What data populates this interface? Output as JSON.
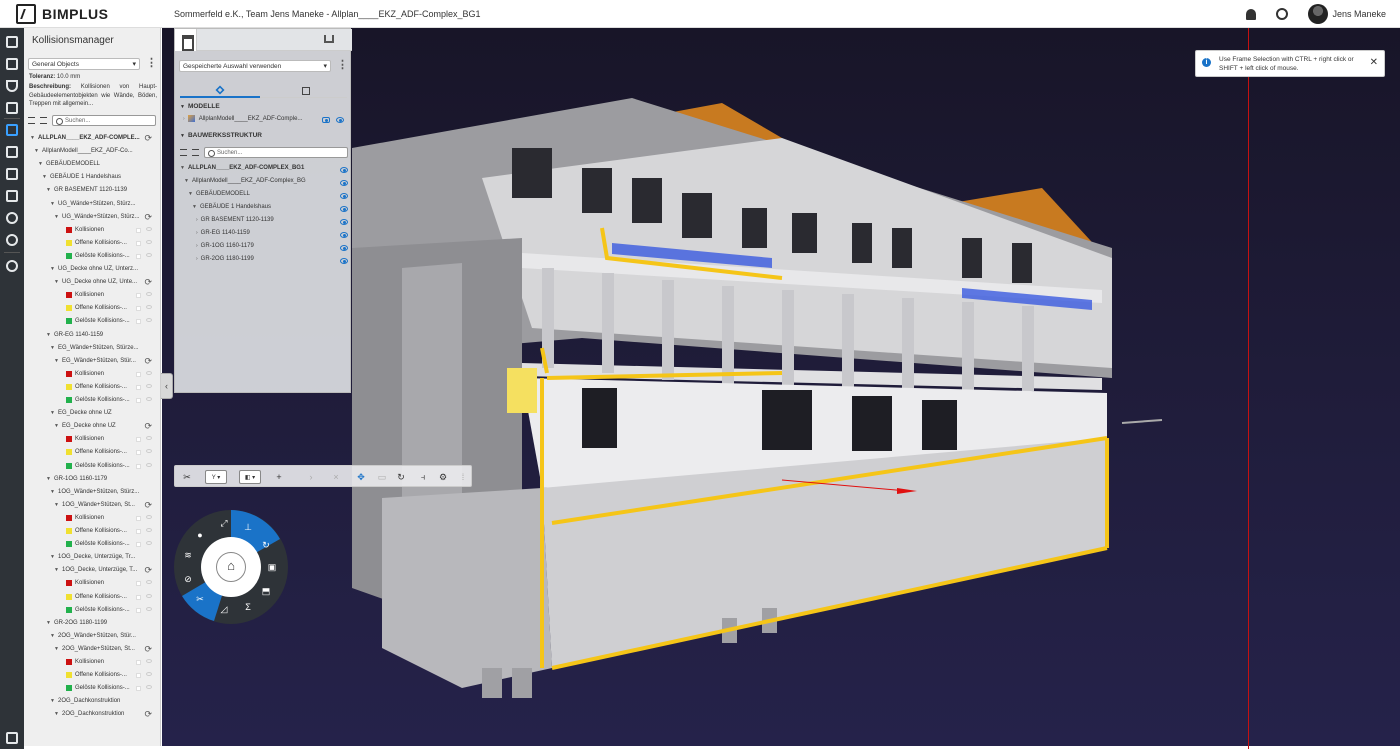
{
  "brand": {
    "name": "BIMPLUS"
  },
  "header": {
    "project_title": "Sommerfeld e.K., Team Jens Maneke  -  Allplan____EKZ_ADF-Complex_BG1",
    "user_name": "Jens Maneke"
  },
  "collision_panel": {
    "title": "Kollisionsmanager",
    "filter_select": "General Objects",
    "tolerance_label": "Toleranz:",
    "tolerance_value": "10.0 mm",
    "description_label": "Beschreibung:",
    "description_text": "Kollisionen von Haupt-Gebäudeelementobjekten wie Wände, Böden, Treppen mit allgemein...",
    "search_placeholder": "Suchen...",
    "tree": [
      {
        "label": "ALLPLAN____EKZ_ADF-COMPLE...",
        "level": 0,
        "kind": "root"
      },
      {
        "label": "AllplanModell____EKZ_ADF-Co...",
        "level": 1,
        "kind": "node"
      },
      {
        "label": "GEBÄUDEMODELL",
        "level": 2,
        "kind": "node"
      },
      {
        "label": "GEBÄUDE 1 Handelshaus",
        "level": 3,
        "kind": "node"
      },
      {
        "label": "GR BASEMENT 1120-1139",
        "level": 4,
        "kind": "node"
      },
      {
        "label": "UG_Wände+Stützen, Stürz...",
        "level": 5,
        "kind": "node"
      },
      {
        "label": "UG_Wände+Stützen, Stürz...",
        "level": 6,
        "kind": "sync"
      },
      {
        "label": "Kollisionen",
        "level": 7,
        "kind": "red"
      },
      {
        "label": "Offene Kollisions-...",
        "level": 7,
        "kind": "yellow"
      },
      {
        "label": "Gelöste Kollisions-...",
        "level": 7,
        "kind": "green"
      },
      {
        "label": "UG_Decke ohne UZ, Unterz...",
        "level": 5,
        "kind": "node"
      },
      {
        "label": "UG_Decke ohne UZ, Unte...",
        "level": 6,
        "kind": "sync"
      },
      {
        "label": "Kollisionen",
        "level": 7,
        "kind": "red"
      },
      {
        "label": "Offene Kollisions-...",
        "level": 7,
        "kind": "yellow"
      },
      {
        "label": "Gelöste Kollisions-...",
        "level": 7,
        "kind": "green"
      },
      {
        "label": "GR-EG 1140-1159",
        "level": 4,
        "kind": "node"
      },
      {
        "label": "EG_Wände+Stützen, Stürze...",
        "level": 5,
        "kind": "node"
      },
      {
        "label": "EG_Wände+Stützen, Stür...",
        "level": 6,
        "kind": "sync"
      },
      {
        "label": "Kollisionen",
        "level": 7,
        "kind": "red"
      },
      {
        "label": "Offene Kollisions-...",
        "level": 7,
        "kind": "yellow"
      },
      {
        "label": "Gelöste Kollisions-...",
        "level": 7,
        "kind": "green"
      },
      {
        "label": "EG_Decke ohne UZ",
        "level": 5,
        "kind": "node"
      },
      {
        "label": "EG_Decke ohne UZ",
        "level": 6,
        "kind": "sync"
      },
      {
        "label": "Kollisionen",
        "level": 7,
        "kind": "red"
      },
      {
        "label": "Offene Kollisions-...",
        "level": 7,
        "kind": "yellow"
      },
      {
        "label": "Gelöste Kollisions-...",
        "level": 7,
        "kind": "green"
      },
      {
        "label": "GR-1OG 1160-1179",
        "level": 4,
        "kind": "node"
      },
      {
        "label": "1OG_Wände+Stützen, Stürz...",
        "level": 5,
        "kind": "node"
      },
      {
        "label": "1OG_Wände+Stützen, St...",
        "level": 6,
        "kind": "sync"
      },
      {
        "label": "Kollisionen",
        "level": 7,
        "kind": "red"
      },
      {
        "label": "Offene Kollisions-...",
        "level": 7,
        "kind": "yellow"
      },
      {
        "label": "Gelöste Kollisions-...",
        "level": 7,
        "kind": "green"
      },
      {
        "label": "1OG_Decke, Unterzüge, Tr...",
        "level": 5,
        "kind": "node"
      },
      {
        "label": "1OG_Decke, Unterzüge, T...",
        "level": 6,
        "kind": "sync"
      },
      {
        "label": "Kollisionen",
        "level": 7,
        "kind": "red"
      },
      {
        "label": "Offene Kollisions-...",
        "level": 7,
        "kind": "yellow"
      },
      {
        "label": "Gelöste Kollisions-...",
        "level": 7,
        "kind": "green"
      },
      {
        "label": "GR-2OG 1180-1199",
        "level": 4,
        "kind": "node"
      },
      {
        "label": "2OG_Wände+Stützen, Stür...",
        "level": 5,
        "kind": "node"
      },
      {
        "label": "2OG_Wände+Stützen, St...",
        "level": 6,
        "kind": "sync"
      },
      {
        "label": "Kollisionen",
        "level": 7,
        "kind": "red"
      },
      {
        "label": "Offene Kollisions-...",
        "level": 7,
        "kind": "yellow"
      },
      {
        "label": "Gelöste Kollisions-...",
        "level": 7,
        "kind": "green"
      },
      {
        "label": "2OG_Dachkonstruktion",
        "level": 5,
        "kind": "node"
      },
      {
        "label": "2OG_Dachkonstruktion",
        "level": 6,
        "kind": "sync"
      }
    ]
  },
  "structure_panel": {
    "selection_select": "Gespeicherte Auswahl verwenden",
    "models_title": "MODELLE",
    "model_item": "AllplanModell____EKZ_ADF-Comple...",
    "structure_title": "BAUWERKSSTRUKTUR",
    "search_placeholder": "Suchen...",
    "tree": [
      {
        "label": "ALLPLAN____EKZ_ADF-COMPLEX_BG1",
        "level": 0,
        "bold": true
      },
      {
        "label": "AllplanModell____EKZ_ADF-Complex_BG",
        "level": 1
      },
      {
        "label": "GEBÄUDEMODELL",
        "level": 2
      },
      {
        "label": "GEBÄUDE 1 Handelshaus",
        "level": 3
      },
      {
        "label": "GR BASEMENT 1120-1139",
        "level": 4
      },
      {
        "label": "GR-EG 1140-1159",
        "level": 4
      },
      {
        "label": "GR-1OG 1160-1179",
        "level": 4
      },
      {
        "label": "GR-2OG 1180-1199",
        "level": 4
      }
    ]
  },
  "notification": {
    "message": "Use Frame Selection with CTRL + right click or SHIFT + left click of mouse."
  },
  "toolbar": {
    "axis_select": "Y",
    "plus": "+",
    "colors": {
      "accent": "#1a73c8",
      "collision_red": "#cc1111",
      "open_yellow": "#f0e030",
      "solved_green": "#22b14c",
      "sidebar": "#2e3338"
    }
  },
  "icons": [
    "cube-icon",
    "map-icon",
    "filter-icon",
    "clipboard-icon",
    "collision-icon",
    "layers-icon",
    "structure-icon",
    "workflow-icon",
    "history-icon",
    "sun-icon",
    "settings-icon",
    "cart-icon",
    "bell-icon",
    "support-icon",
    "home-icon"
  ]
}
